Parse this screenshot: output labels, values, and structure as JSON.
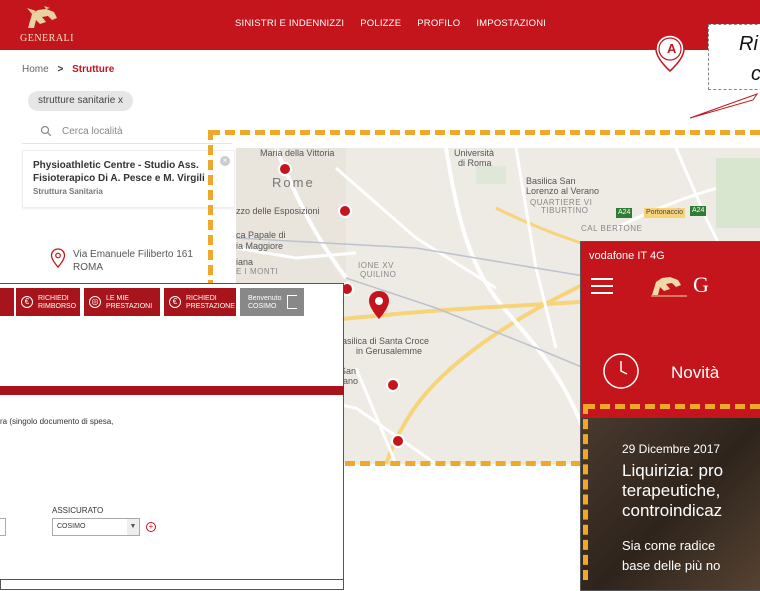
{
  "header": {
    "brand": "GENERALI",
    "nav": [
      "SINISTRI E INDENNIZZI",
      "POLIZZE",
      "PROFILO",
      "IMPOSTAZIONI"
    ],
    "color": "#c4151c"
  },
  "breadcrumb": {
    "home": "Home",
    "separator": ">",
    "current": "Strutture"
  },
  "filter_chip": "strutture sanitarie  x",
  "search": {
    "placeholder": "Cerca località"
  },
  "result": {
    "name": "Physioathletic Centre - Studio Ass. Fisioterapico Di A. Pesce e M. Virgili",
    "type": "Struttura Sanitaria",
    "street": "Via Emanuele Filiberto 161",
    "city": "ROMA"
  },
  "callout": {
    "badge": "A",
    "line1": "Ri",
    "line2": "c"
  },
  "map": {
    "labels": {
      "maria_vittoria": "Maria della Vittoria",
      "rome": "Rome",
      "esposizioni": "zzo delle Esposizioni",
      "palazzo": "ca Papale di",
      "maggiore": "ia Maggiore",
      "iana": "iana",
      "monti": "E I MONTI",
      "universita_1": "Università",
      "universita_2": "di Roma",
      "basilica_san_1": "Basilica San",
      "basilica_san_2": "Lorenzo al Verano",
      "quartiere_1": "QUARTIERE VI",
      "quartiere_2": "TIBURTINO",
      "rione_1": "IONE XV",
      "rione_2": "QUILINO",
      "santa_croce_1": "Basilica di Santa Croce",
      "santa_croce_2": "in Gerusalemme",
      "san_1": "San",
      "san_2": "rano",
      "cal_bertone": "CAL BERTONE",
      "portonaccio": "Portonaccio",
      "a24_1": "A24",
      "a24_2": "A24"
    }
  },
  "desktop": {
    "buttons": [
      {
        "label1": "RICHIEDI",
        "label2": "RIMBORSO"
      },
      {
        "label1": "LE MIE",
        "label2": "PRESTAZIONI"
      },
      {
        "label1": "RICHIEDI",
        "label2": "PRESTAZIONE"
      },
      {
        "label1": "Benvenuto",
        "label2": "COSIMO"
      }
    ],
    "note": "ra (singolo documento di spesa,",
    "assicurato_label": "ASSICURATO",
    "assicurato_value": "COSIMO"
  },
  "phone": {
    "status": "vodafone IT  4G",
    "brand": "G",
    "novita": "Novità",
    "date": "29 Dicembre 2017",
    "title_lines": [
      "Liquirizia: pro",
      "terapeutiche,",
      "controindicaz"
    ],
    "body_lines": [
      "Sia come radice",
      "base delle più no"
    ]
  },
  "highlight_color": "#f0a82a"
}
